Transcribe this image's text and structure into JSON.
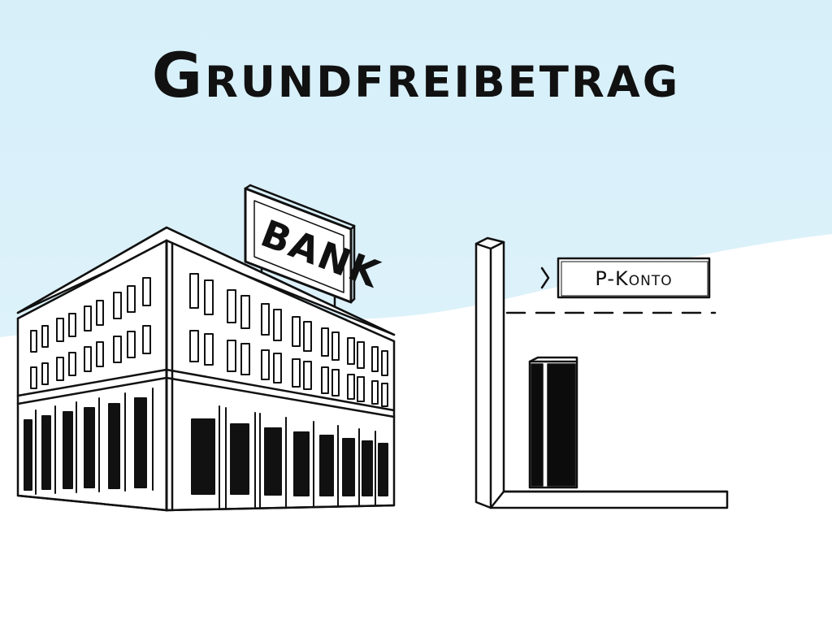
{
  "title": "Grundfreibetrag",
  "bank": {
    "sign_text": "BANK"
  },
  "account": {
    "label": "P-Konto"
  },
  "colors": {
    "sky": "#d9f0fa",
    "ground": "#ffffff",
    "ink": "#111111",
    "door": "#0c0c0c"
  },
  "icons": {
    "label_marker": "chevron-right-icon"
  }
}
